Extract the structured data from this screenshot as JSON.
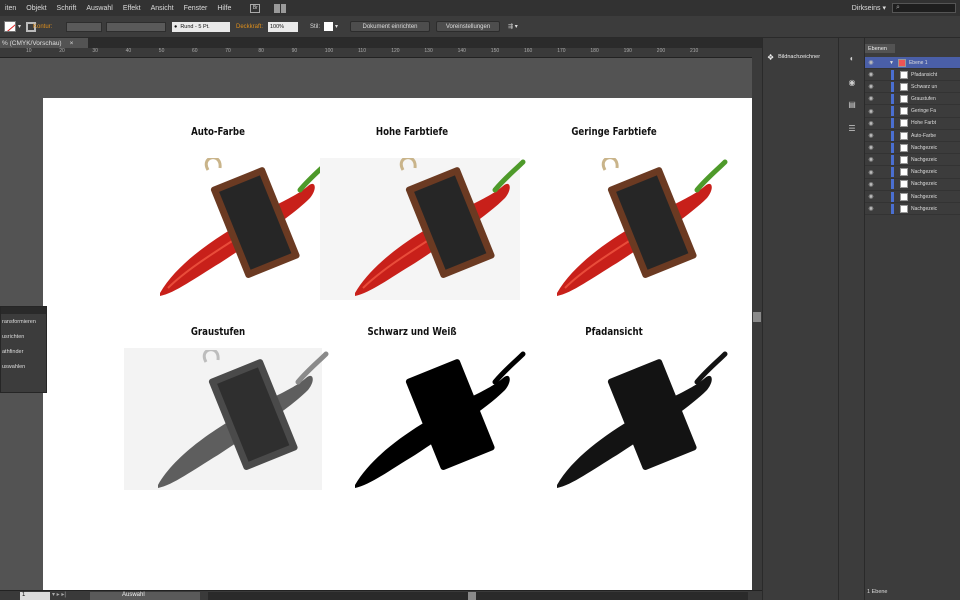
{
  "menubar": {
    "items": [
      "iten",
      "Objekt",
      "Schrift",
      "Auswahl",
      "Effekt",
      "Ansicht",
      "Fenster",
      "Hilfe"
    ],
    "workspace": "Dirkseins",
    "search_placeholder": ""
  },
  "controlbar": {
    "kontur_label": "Kontur:",
    "stroke_style": "Rund - 5 Pt.",
    "deckkraft_label": "Deckkraft:",
    "opacity": "100%",
    "stil_label": "Stil:",
    "doc_setup_button": "Dokument einrichten",
    "preferences_button": "Voreinstellungen"
  },
  "document": {
    "tab_title": "% (CMYK/Vorschau)",
    "close": "×"
  },
  "ruler": {
    "ticks": [
      "10",
      "20",
      "30",
      "40",
      "50",
      "60",
      "70",
      "80",
      "90",
      "100",
      "110",
      "120",
      "130",
      "140",
      "150",
      "160",
      "170",
      "180",
      "190",
      "200",
      "210"
    ]
  },
  "artboard": {
    "titles": [
      "Auto-Farbe",
      "Hohe Farbtiefe",
      "Geringe Farbtiefe",
      "Graustufen",
      "Schwarz und Weiß",
      "Pfadansicht"
    ]
  },
  "floating_panel": {
    "items": [
      "ransformieren",
      "usrichten",
      "athfinder",
      "uswahlen"
    ]
  },
  "dock": {
    "image_trace": "Bildnachzeichner"
  },
  "layers_panel": {
    "tab": "Ebenen",
    "top_layer": "Ebene 1",
    "rows": [
      "Pfadansicht",
      "Schwarz un",
      "Graustufen",
      "Geringe Fa",
      "Hohe Farbt",
      "Auto-Farbe",
      "Nachgezeic",
      "Nachgezeic",
      "Nachgezeic",
      "Nachgezeic",
      "Nachgezeic",
      "Nachgezeic"
    ],
    "footer": "1 Ebene"
  },
  "statusbar": {
    "page": "1",
    "tool": "Auswahl"
  },
  "colors": {
    "accent_orange": "#e0901c",
    "layer_select_blue": "#4a5fa8",
    "pepper_red": "#c8201a",
    "board_brown": "#6b3a22"
  }
}
